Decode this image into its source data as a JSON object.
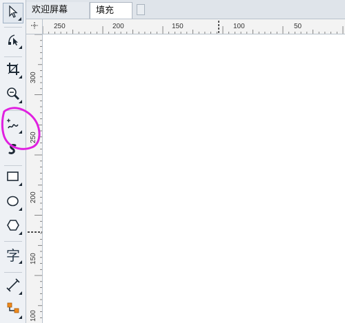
{
  "tabs": {
    "welcome_label": "欢迎屏幕",
    "fill_label": "填充"
  },
  "toolbox": {
    "tools": [
      {
        "name": "pick-tool",
        "icon": "arrow-pointer-icon"
      },
      {
        "name": "shape-tool",
        "icon": "shape-node-icon"
      },
      {
        "name": "crop-tool",
        "icon": "crop-icon"
      },
      {
        "name": "zoom-tool",
        "icon": "magnifier-icon"
      },
      {
        "name": "freehand-tool",
        "icon": "freehand-line-icon"
      },
      {
        "name": "smart-draw-tool",
        "icon": "artistic-media-icon"
      },
      {
        "name": "rectangle-tool",
        "icon": "rectangle-icon"
      },
      {
        "name": "ellipse-tool",
        "icon": "ellipse-icon"
      },
      {
        "name": "polygon-tool",
        "icon": "polygon-icon"
      },
      {
        "name": "text-tool",
        "icon": "text-icon",
        "label": "字"
      },
      {
        "name": "dimension-tool",
        "icon": "dimension-icon"
      },
      {
        "name": "connector-tool",
        "icon": "connector-icon"
      }
    ]
  },
  "ruler": {
    "horizontal_labels": [
      "250",
      "200",
      "150",
      "100",
      "50"
    ],
    "vertical_labels": [
      "300",
      "250",
      "200",
      "150",
      "100"
    ]
  },
  "colors": {
    "annotation": "#e020e0",
    "canvas": "#ffffff",
    "ruler_bg": "#f3f3f3"
  }
}
